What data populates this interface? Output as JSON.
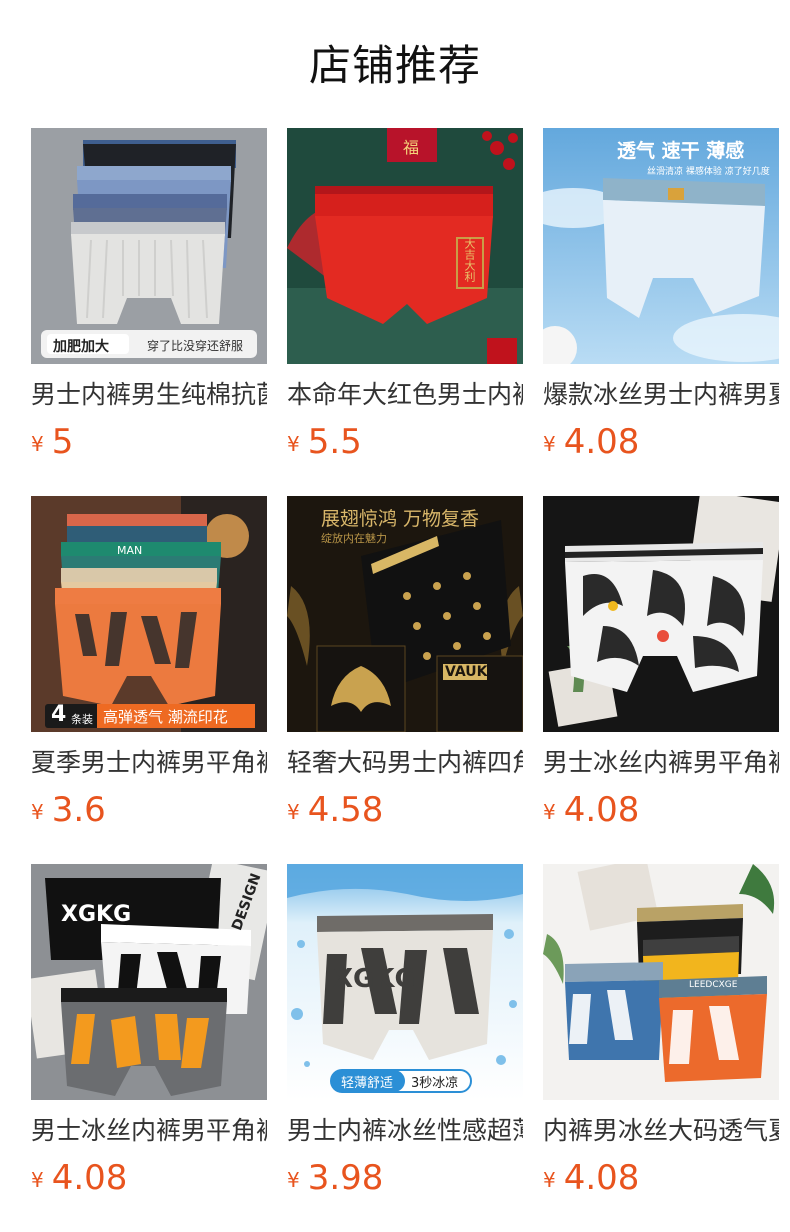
{
  "header": {
    "title": "店铺推荐"
  },
  "currency_symbol": "¥",
  "products": [
    {
      "name": "男士内裤男生纯棉抗菌",
      "price": "5",
      "badge": {
        "left": "加肥加大",
        "right": "穿了比没穿还舒服"
      }
    },
    {
      "name": "本命年大红色男士内裤",
      "price": "5.5",
      "badge": {
        "fu": "福",
        "print": "大吉大利"
      }
    },
    {
      "name": "爆款冰丝男士内裤男夏",
      "price": "4.08",
      "badge": {
        "headline": "透气 速干 薄感",
        "sub": "丝滑清凉 裸感体验 凉了好几度"
      }
    },
    {
      "name": "夏季男士内裤男平角裤",
      "price": "3.6",
      "badge": {
        "count": "4",
        "unit": "条装",
        "text": "高弹透气 潮流印花",
        "brand": "MAN"
      }
    },
    {
      "name": "轻奢大码男士内裤四角",
      "price": "4.58",
      "badge": {
        "headline": "展翅惊鸿 万物复香",
        "sub": "绽放内在魅力",
        "brand": "VAUK"
      }
    },
    {
      "name": "男士冰丝内裤男平角裤",
      "price": "4.08"
    },
    {
      "name": "男士冰丝内裤男平角裤",
      "price": "4.08",
      "badge": {
        "brand": "XGKG",
        "deco": "DESIGN"
      }
    },
    {
      "name": "男士内裤冰丝性感超薄",
      "price": "3.98",
      "badge": {
        "brand": "XGKG",
        "left": "轻薄舒适",
        "right": "3秒冰凉"
      }
    },
    {
      "name": "内裤男冰丝大码透气夏",
      "price": "4.08",
      "badge": {
        "brand": "LEEDCXGE"
      }
    }
  ]
}
